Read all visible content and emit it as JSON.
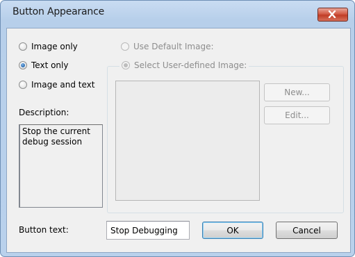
{
  "window": {
    "title": "Button Appearance",
    "close_icon": "close-icon"
  },
  "appearance_options": [
    {
      "label": "Image only",
      "checked": false
    },
    {
      "label": "Text only",
      "checked": true
    },
    {
      "label": "Image and text",
      "checked": false
    }
  ],
  "description": {
    "label": "Description:",
    "text": "Stop the current debug session"
  },
  "image_source": {
    "use_default_label": "Use Default Image:",
    "user_defined_label": "Select User-defined Image:",
    "new_button": "New...",
    "edit_button": "Edit..."
  },
  "button_text": {
    "label": "Button text:",
    "value": "Stop Debugging"
  },
  "actions": {
    "ok": "OK",
    "cancel": "Cancel"
  },
  "colors": {
    "frame": "#b9d1ec",
    "client": "#f0f0f0",
    "close_button": "#c03d26",
    "default_button_border": "#3c7fb1"
  }
}
